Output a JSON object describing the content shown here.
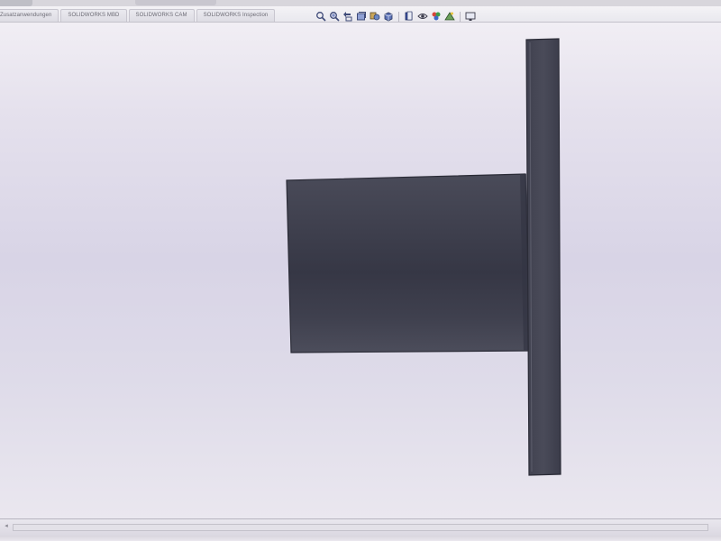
{
  "app": {
    "tabs": [
      {
        "label": "Zusatzanwendungen"
      },
      {
        "label": "SOLIDWORKS MBD"
      },
      {
        "label": "SOLIDWORKS CAM"
      },
      {
        "label": "SOLIDWORKS Inspection"
      }
    ],
    "heads_up_toolbar": {
      "icons": [
        "zoom-to-fit-icon",
        "zoom-to-area-icon",
        "previous-view-icon",
        "section-view-icon",
        "dynamic-annotation-view-icon",
        "view-orientation-icon",
        "display-style-icon",
        "hide-show-items-icon",
        "edit-appearance-icon",
        "apply-scene-icon",
        "view-settings-icon"
      ]
    },
    "colors": {
      "part": "#3d3e4c",
      "part_highlight": "#545563",
      "viewport_bg": "#dcd8e8"
    }
  }
}
